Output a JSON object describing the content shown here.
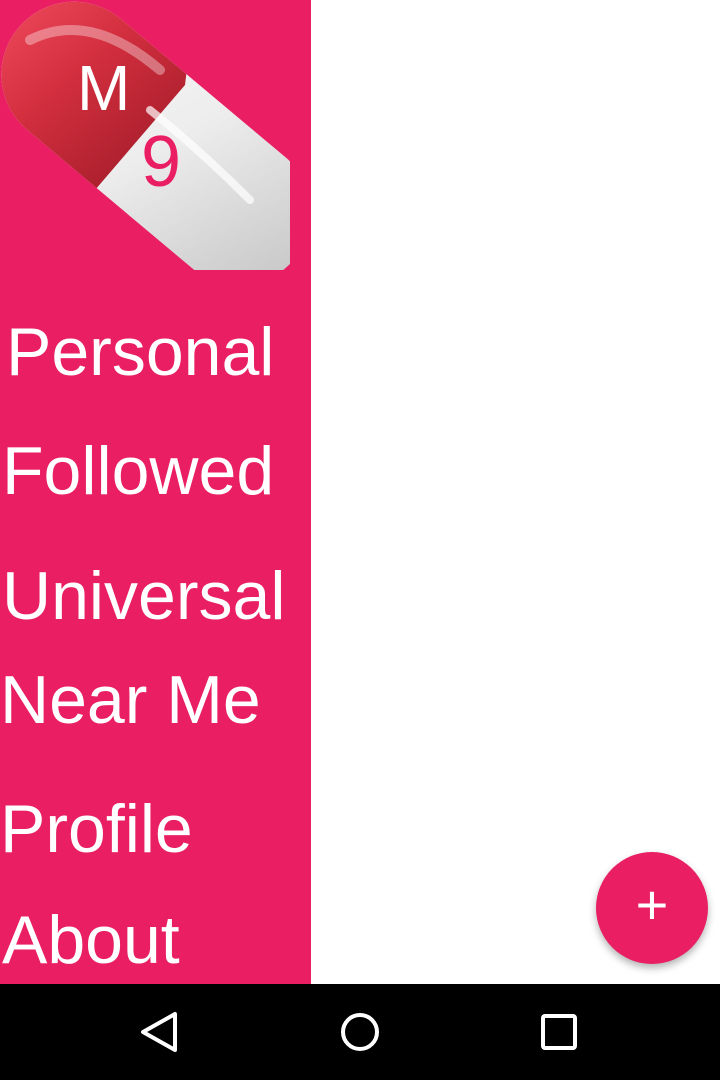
{
  "colors": {
    "accent": "#E91E63",
    "capsule_red": "#D32F3F",
    "capsule_white": "#F2F2F2",
    "content_background": "#FFFFFF",
    "navbar": "#000000"
  },
  "logo": {
    "letter": "M",
    "digit": "9",
    "icon": "pill-capsule-icon"
  },
  "drawer": {
    "items": [
      {
        "label": "Personal"
      },
      {
        "label": "Followed"
      },
      {
        "label": "Universal"
      },
      {
        "label": "Near Me"
      },
      {
        "label": "Profile"
      },
      {
        "label": "About"
      }
    ]
  },
  "fab": {
    "label": "+",
    "icon": "plus-icon"
  },
  "navigation_bar": {
    "buttons": [
      "back-icon",
      "home-icon",
      "recents-icon"
    ]
  }
}
